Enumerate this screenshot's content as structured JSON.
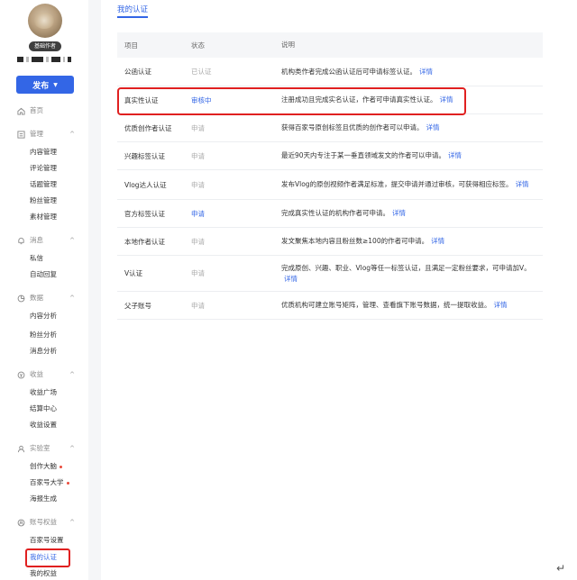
{
  "sidebar": {
    "badge": "基础作者",
    "publish_label": "发布",
    "home": "首页",
    "groups": [
      {
        "label": "管理",
        "icon": "manage-icon",
        "items": [
          "内容管理",
          "评论管理",
          "话题管理",
          "粉丝管理",
          "素材管理"
        ]
      },
      {
        "label": "消息",
        "icon": "bell-icon",
        "items": [
          "私信",
          "自动回复"
        ]
      },
      {
        "label": "数据",
        "icon": "pie-chart-icon",
        "items": [
          "内容分析",
          "粉丝分析",
          "消息分析"
        ]
      },
      {
        "label": "收益",
        "icon": "coin-icon",
        "items": [
          "收益广场",
          "结算中心",
          "收益设置"
        ]
      },
      {
        "label": "实验室",
        "icon": "lab-icon",
        "items": [
          "创作大脑",
          "百家号大学",
          "海报生成"
        ]
      },
      {
        "label": "账号权益",
        "icon": "account-icon",
        "items": [
          "百家号设置",
          "我的认证",
          "我的权益"
        ]
      }
    ]
  },
  "main": {
    "tab": "我的认证",
    "headers": [
      "项目",
      "状态",
      "说明"
    ],
    "detail_label": "详情",
    "rows": [
      {
        "name": "公函认证",
        "status": "已认证",
        "status_type": "done",
        "desc": "机构类作者完成公函认证后可申请标签认证。"
      },
      {
        "name": "真实性认证",
        "status": "审核中",
        "status_type": "link",
        "desc": "注册成功且完成实名认证，作者可申请真实性认证。"
      },
      {
        "name": "优质创作者认证",
        "status": "申请",
        "status_type": "apply",
        "desc": "获得百家号原创标签且优质的创作者可以申请。"
      },
      {
        "name": "兴趣标签认证",
        "status": "申请",
        "status_type": "apply",
        "desc": "最近90天内专注于某一垂直领域发文的作者可以申请。"
      },
      {
        "name": "Vlog达人认证",
        "status": "申请",
        "status_type": "apply",
        "desc": "发布Vlog的原创视频作者满足标准，提交申请并通过审核，可获得相应标签。"
      },
      {
        "name": "官方标签认证",
        "status": "申请",
        "status_type": "link",
        "desc": "完成真实性认证的机构作者可申请。"
      },
      {
        "name": "本地作者认证",
        "status": "申请",
        "status_type": "apply",
        "desc": "发文聚焦本地内容且粉丝数≥100的作者可申请。"
      },
      {
        "name": "V认证",
        "status": "申请",
        "status_type": "apply",
        "desc": "完成原创、兴趣、职业、Vlog等任一标签认证，且满足一定粉丝要求，可申请加V。"
      },
      {
        "name": "父子账号",
        "status": "申请",
        "status_type": "apply",
        "desc": "优质机构可建立账号矩阵，管理、查看旗下账号数据，统一提取收益。"
      }
    ]
  },
  "colors": {
    "accent": "#3366e6",
    "highlight": "#e02020"
  }
}
